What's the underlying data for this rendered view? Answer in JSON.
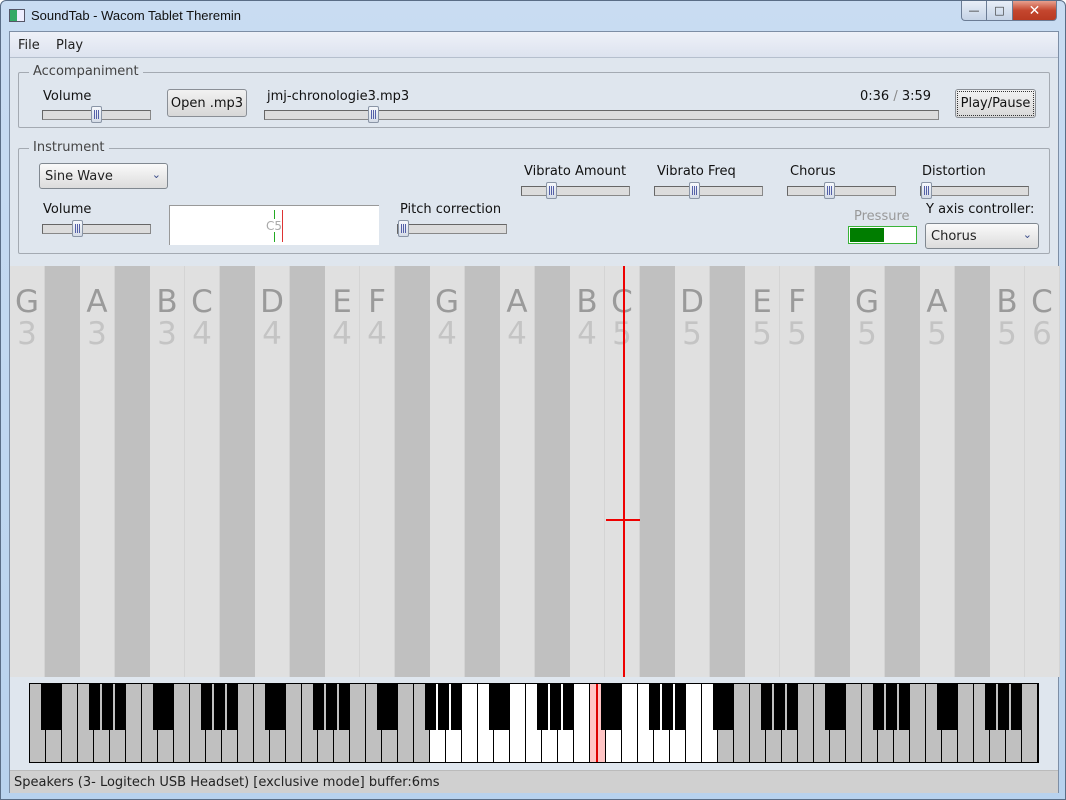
{
  "window": {
    "title": "SoundTab - Wacom Tablet Theremin",
    "controls": {
      "minimize": "—",
      "maximize": "□",
      "close": "✕"
    }
  },
  "menu": {
    "items": [
      {
        "label": "File"
      },
      {
        "label": "Play"
      }
    ]
  },
  "accompaniment": {
    "group_label": "Accompaniment",
    "volume_label": "Volume",
    "volume_value": 0.5,
    "open_button": "Open .mp3",
    "file_name": "jmj-chronologie3.mp3",
    "position_value": 0.155,
    "time_current": "0:36",
    "time_separator": "/",
    "time_total": "3:59",
    "play_pause_button": "Play/Pause"
  },
  "instrument": {
    "group_label": "Instrument",
    "waveform_selected": "Sine Wave",
    "volume_label": "Volume",
    "volume_value": 0.3,
    "tuner_note": "C5",
    "pitch_correction_label": "Pitch correction",
    "pitch_correction_value": 0.0,
    "vibrato_amount_label": "Vibrato Amount",
    "vibrato_amount_value": 0.25,
    "vibrato_freq_label": "Vibrato Freq",
    "vibrato_freq_value": 0.35,
    "chorus_label": "Chorus",
    "chorus_value": 0.37,
    "distortion_label": "Distortion",
    "distortion_value": 0.0,
    "pressure_label": "Pressure",
    "pressure_value": 0.5,
    "y_axis_label": "Y axis controller:",
    "y_axis_selected": "Chorus"
  },
  "note_strip": {
    "columns": [
      {
        "note": "G",
        "octave": "3",
        "black": false
      },
      {
        "black": true
      },
      {
        "note": "A",
        "octave": "3",
        "black": false
      },
      {
        "black": true
      },
      {
        "note": "B",
        "octave": "3",
        "black": false
      },
      {
        "note": "C",
        "octave": "4",
        "black": false
      },
      {
        "black": true
      },
      {
        "note": "D",
        "octave": "4",
        "black": false
      },
      {
        "black": true
      },
      {
        "note": "E",
        "octave": "4",
        "black": false
      },
      {
        "note": "F",
        "octave": "4",
        "black": false
      },
      {
        "black": true
      },
      {
        "note": "G",
        "octave": "4",
        "black": false
      },
      {
        "black": true
      },
      {
        "note": "A",
        "octave": "4",
        "black": false
      },
      {
        "black": true
      },
      {
        "note": "B",
        "octave": "4",
        "black": false
      },
      {
        "note": "C",
        "octave": "5",
        "black": false
      },
      {
        "black": true
      },
      {
        "note": "D",
        "octave": "5",
        "black": false
      },
      {
        "black": true
      },
      {
        "note": "E",
        "octave": "5",
        "black": false
      },
      {
        "note": "F",
        "octave": "5",
        "black": false
      },
      {
        "black": true
      },
      {
        "note": "G",
        "octave": "5",
        "black": false
      },
      {
        "black": true
      },
      {
        "note": "A",
        "octave": "5",
        "black": false
      },
      {
        "black": true
      },
      {
        "note": "B",
        "octave": "5",
        "black": false
      },
      {
        "note": "C",
        "octave": "6",
        "black": false
      }
    ],
    "current_note": "C5"
  },
  "keyboard": {
    "white_key_count": 63,
    "active_range_white_index": [
      25,
      42
    ],
    "played_white_index": 35
  },
  "colors": {
    "pressure_fill": "#007d00",
    "cursor": "#e00000",
    "tuner_target": "#22aa22"
  },
  "status": {
    "text": "Speakers (3- Logitech USB Headset) [exclusive mode] buffer:6ms"
  }
}
